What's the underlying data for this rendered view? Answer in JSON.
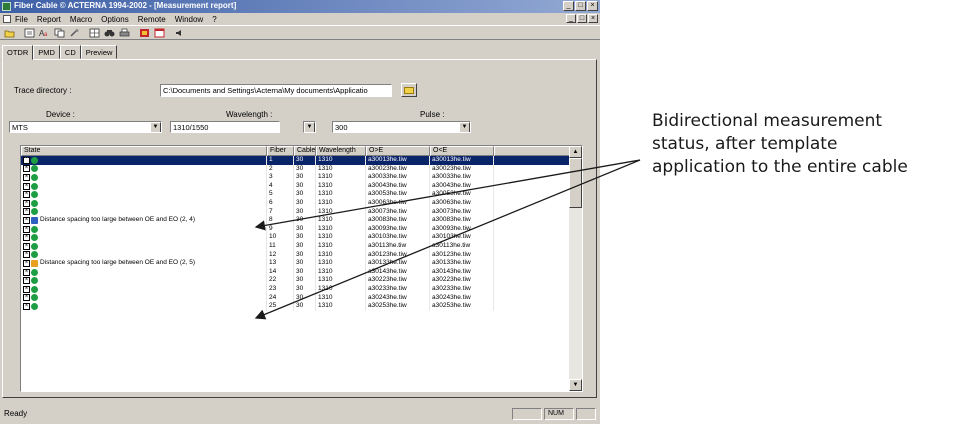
{
  "window": {
    "title": "Fiber Cable © ACTERNA 1994-2002 - [Measurement report]",
    "btn_min": "_",
    "btn_max": "□",
    "btn_close": "×"
  },
  "menu": [
    "File",
    "Report",
    "Macro",
    "Options",
    "Remote",
    "Window",
    "?"
  ],
  "tabs": [
    "OTDR",
    "PMD",
    "CD",
    "Preview"
  ],
  "form": {
    "trace_dir_label": "Trace directory :",
    "trace_dir_value": "C:\\Documents and Settings\\Acterna\\My documents\\Applicatio",
    "device_label": "Device :",
    "device_value": "MTS",
    "wavelength_label": "Wavelength :",
    "wavelength_value": "1310/1550",
    "wavelength_value2": "",
    "pulse_label": "Pulse :",
    "pulse_value": "300"
  },
  "grid": {
    "columns": [
      "State",
      "Fiber",
      "Cable",
      "Wavelength",
      "O>E",
      "O<E"
    ],
    "rows": [
      {
        "state": "",
        "fiber": "1",
        "cable": "30",
        "wl": "1310",
        "oe": "a30013he.tiw",
        "eo": "a30013he.tiw",
        "selected": true
      },
      {
        "state": "",
        "fiber": "2",
        "cable": "30",
        "wl": "1310",
        "oe": "a30023he.tiw",
        "eo": "a30023he.tiw"
      },
      {
        "state": "",
        "fiber": "3",
        "cable": "30",
        "wl": "1310",
        "oe": "a30033he.tiw",
        "eo": "a30033he.tiw"
      },
      {
        "state": "",
        "fiber": "4",
        "cable": "30",
        "wl": "1310",
        "oe": "a30043he.tiw",
        "eo": "a30043he.tiw"
      },
      {
        "state": "",
        "fiber": "5",
        "cable": "30",
        "wl": "1310",
        "oe": "a30053he.tiw",
        "eo": "a30053he.tiw"
      },
      {
        "state": "",
        "fiber": "6",
        "cable": "30",
        "wl": "1310",
        "oe": "a30063he.tiw",
        "eo": "a30063he.tiw"
      },
      {
        "state": "",
        "fiber": "7",
        "cable": "30",
        "wl": "1310",
        "oe": "a30073he.tiw",
        "eo": "a30073he.tiw"
      },
      {
        "state": "Distance spacing too large between OE and EO (2, 4)",
        "fiber": "8",
        "cable": "30",
        "wl": "1310",
        "oe": "a30083he.tiw",
        "eo": "a30083he.tiw",
        "warn": "blue"
      },
      {
        "state": "",
        "fiber": "9",
        "cable": "30",
        "wl": "1310",
        "oe": "a30093he.tiw",
        "eo": "a30093he.tiw"
      },
      {
        "state": "",
        "fiber": "10",
        "cable": "30",
        "wl": "1310",
        "oe": "a30103he.tiw",
        "eo": "a30103he.tiw"
      },
      {
        "state": "",
        "fiber": "11",
        "cable": "30",
        "wl": "1310",
        "oe": "a30113he.tiw",
        "eo": "a30113he.tiw"
      },
      {
        "state": "",
        "fiber": "12",
        "cable": "30",
        "wl": "1310",
        "oe": "a30123he.tiw",
        "eo": "a30123he.tiw"
      },
      {
        "state": "Distance spacing too large between OE and EO (2, 5)",
        "fiber": "13",
        "cable": "30",
        "wl": "1310",
        "oe": "a30133he.tiw",
        "eo": "a30133he.tiw",
        "warn": "orange"
      },
      {
        "state": "",
        "fiber": "14",
        "cable": "30",
        "wl": "1310",
        "oe": "a30143he.tiw",
        "eo": "a30143he.tiw"
      },
      {
        "state": "",
        "fiber": "22",
        "cable": "30",
        "wl": "1310",
        "oe": "a30223he.tiw",
        "eo": "a30223he.tiw"
      },
      {
        "state": "",
        "fiber": "23",
        "cable": "30",
        "wl": "1310",
        "oe": "a30233he.tiw",
        "eo": "a30233he.tiw"
      },
      {
        "state": "",
        "fiber": "24",
        "cable": "30",
        "wl": "1310",
        "oe": "a30243he.tiw",
        "eo": "a30243he.tiw"
      },
      {
        "state": "",
        "fiber": "25",
        "cable": "30",
        "wl": "1310",
        "oe": "a30253he.tiw",
        "eo": "a30253he.tiw"
      }
    ]
  },
  "status": {
    "text": "Ready",
    "pane1": "",
    "pane2": "NUM",
    "pane3": ""
  },
  "annotation": {
    "lines": [
      "Bidirectional measurement",
      "status, after template",
      "application to the entire cable"
    ]
  },
  "colors": {
    "selection": "#0a246a",
    "status_ok": "#1e9e43"
  }
}
